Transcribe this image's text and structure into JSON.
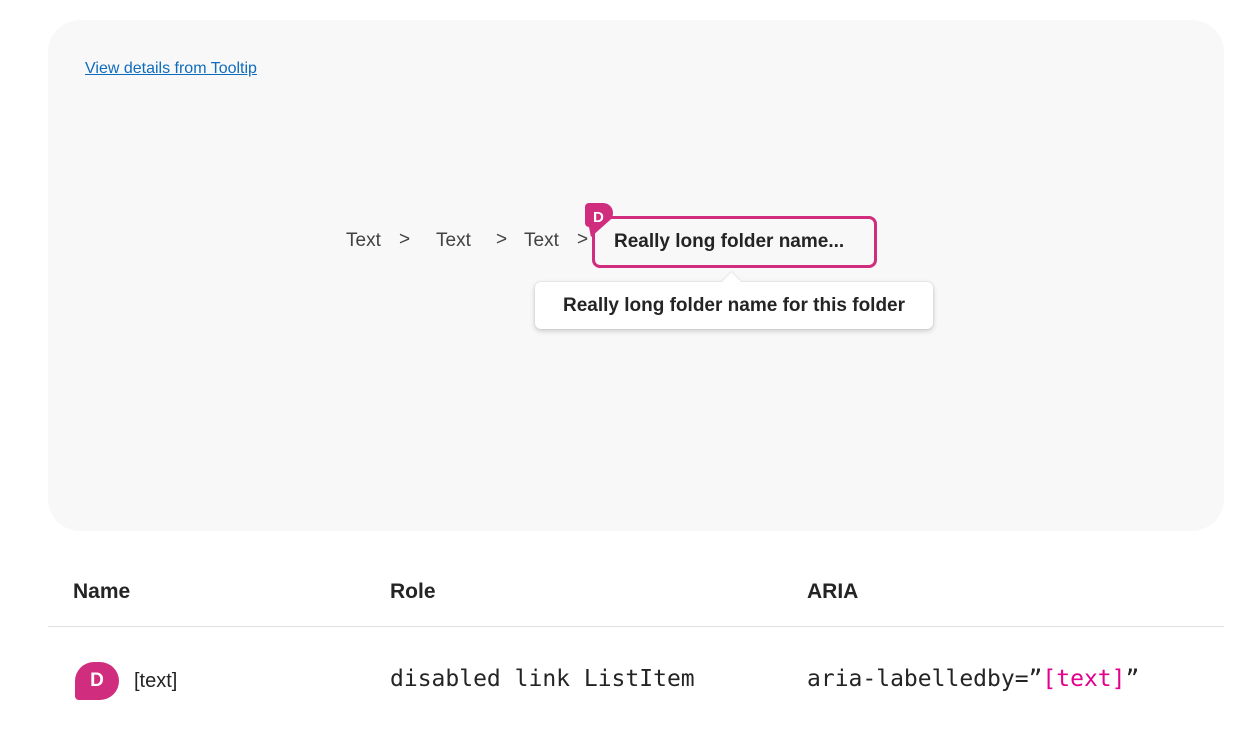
{
  "stage": {
    "link_text": "View details from Tooltip",
    "breadcrumb": {
      "items": [
        "Text",
        "Text",
        "Text"
      ],
      "separator": ">",
      "current": "Really long folder name..."
    },
    "tooltip_text": "Really long folder name for this folder",
    "badge_letter": "D"
  },
  "table": {
    "headers": [
      "Name",
      "Role",
      "ARIA"
    ],
    "row": {
      "badge_letter": "D",
      "name": "[text]",
      "role": "disabled link ListItem",
      "aria_prefix": "aria-labelledby=”",
      "aria_value": "[text]",
      "aria_suffix": "”"
    }
  },
  "colors": {
    "accent": "#d12d7e",
    "link": "#0f6cbd",
    "aria_value": "#e3008c"
  }
}
